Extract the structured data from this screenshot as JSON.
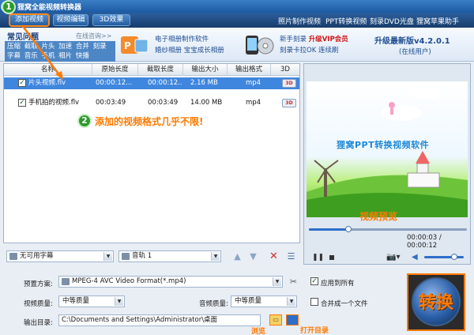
{
  "window": {
    "title": "狸窝全能视频转换器"
  },
  "toolbar": {
    "add_video": "添加视频",
    "edit_video": "视频编辑",
    "effect_3d": "3D效果",
    "links": [
      "照片制作视频",
      "PPT转换视频",
      "刻录DVD光盘",
      "狸窝苹果助手"
    ]
  },
  "banner": {
    "faq_title": "常见问题",
    "faq_online": "在线咨询>>",
    "faq_links": [
      "压缩",
      "截取",
      "片头",
      "加速",
      "合并",
      "刻录",
      "字幕",
      "音乐",
      "手机",
      "相片",
      "快播"
    ],
    "promo_left": [
      "电子相册制作软件",
      "婚纱相册 宝宝成长相册"
    ],
    "promo_right_line1_prefix": "新手刻录",
    "promo_right_vip": "升级VIP会员",
    "promo_right_line2": "刻录卡拉OK 连续刷",
    "version": "升级最新版v4.2.0.1",
    "status": "(在线用户)"
  },
  "table": {
    "headers": [
      "名称",
      "原始长度",
      "截取长度",
      "输出大小",
      "输出格式",
      "3D"
    ],
    "rows": [
      {
        "checked": "✓",
        "name": "片头视频.flv",
        "orig": "00:00:12...",
        "cut": "00:00:12...",
        "size": "2.16 MB",
        "fmt": "mp4",
        "d3": "3D"
      },
      {
        "checked": "✓",
        "name": "手机拍的视频.flv",
        "orig": "00:03:49",
        "cut": "00:03:49",
        "size": "14.00 MB",
        "fmt": "mp4",
        "d3": "3D"
      }
    ]
  },
  "annotations": {
    "step1": "1",
    "step2": "2",
    "step2_text": "添加的视频格式几乎不限!",
    "preview_text": "视频预览",
    "browse_hint": "浏览",
    "open_hint": "打开目录"
  },
  "subtitle": {
    "value": "无可用字幕"
  },
  "audio": {
    "value": "音轨 1"
  },
  "preview": {
    "screen_title": "狸窝PPT转换视频软件",
    "time": "00:00:03 / 00:00:12",
    "progress_fraction": 0.25,
    "volume_fraction": 0.75
  },
  "settings": {
    "preset_label": "预置方案:",
    "preset_value": "MPEG-4 AVC Video Format(*.mp4)",
    "apply_all_checked": "✓",
    "apply_all_label": "应用到所有",
    "video_quality_label": "视频质量:",
    "video_quality_value": "中等质量",
    "audio_quality_label": "音频质量:",
    "audio_quality_value": "中等质量",
    "merge_label": "合并成一个文件",
    "output_label": "输出目录:",
    "output_path": "C:\\Documents and Settings\\Administrator\\桌面",
    "convert_label": "转换"
  },
  "colors": {
    "accent": "#ff7a00",
    "title_bar": "#1b5aa3",
    "selected_row": "#3f86de"
  }
}
